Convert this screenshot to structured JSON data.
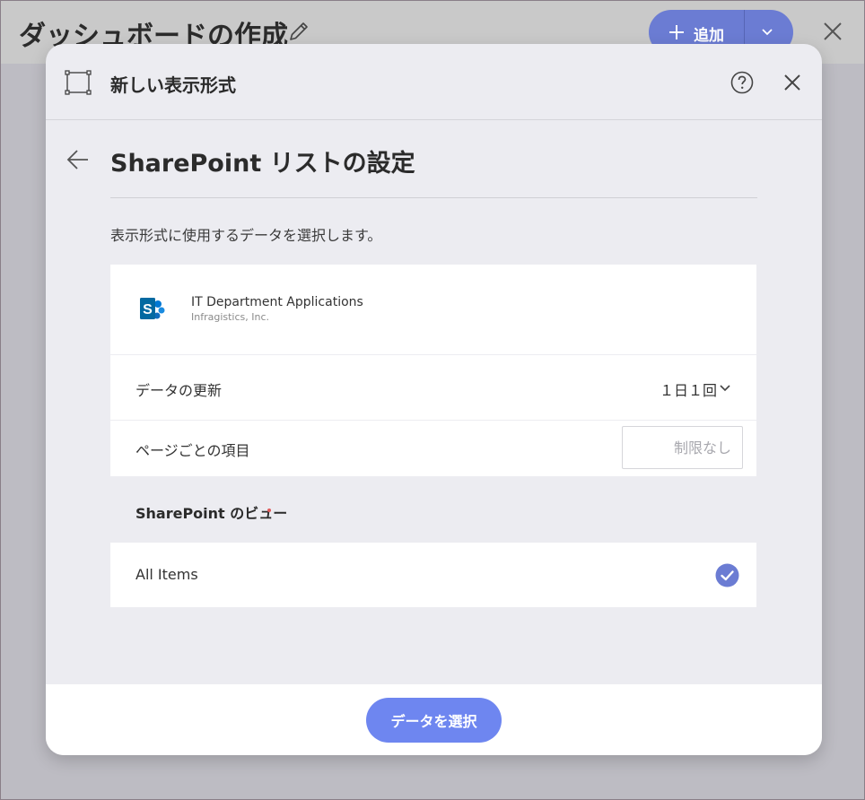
{
  "app": {
    "dashboard_title": "ダッシュボードの作成",
    "add_label": "追加",
    "accent": "#6b7cd3"
  },
  "modal": {
    "title": "新しい表示形式",
    "section_title": "SharePoint リストの設定",
    "description": "表示形式に使用するデータを選択します。",
    "source": {
      "name": "IT Department Applications",
      "subtitle": "Infragistics, Inc."
    },
    "refresh": {
      "label": "データの更新",
      "value": "１日１回"
    },
    "items_per_page": {
      "label": "ページごとの項目",
      "placeholder": "制限なし",
      "value": ""
    },
    "view": {
      "label": "SharePoint のビュー",
      "items": [
        {
          "label": "All Items",
          "selected": true
        }
      ]
    },
    "select_button": "データを選択",
    "button_color": "#6e86f0",
    "required_color": "#e05a5a"
  },
  "icons": {
    "pencil": "pencil-icon",
    "plus": "plus-icon",
    "chevron": "chevron-down-icon",
    "close": "close-icon",
    "frame": "visualization-frame-icon",
    "help": "help-icon",
    "back": "back-arrow-icon",
    "sharepoint": "sharepoint-logo-icon",
    "check": "check-circle-icon"
  }
}
